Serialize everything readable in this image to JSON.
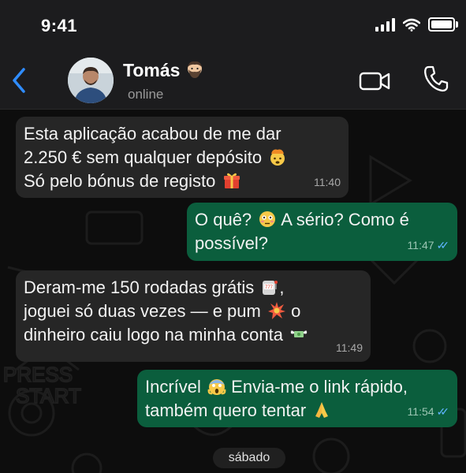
{
  "status_bar": {
    "time": "9:41"
  },
  "header": {
    "name": "Tomás",
    "status": "online"
  },
  "messages": [
    {
      "direction": "incoming",
      "lines": [
        "Esta aplicação acabou de me dar",
        "2.250 € sem qualquer depósito",
        "Só pelo bónus de registo"
      ],
      "emojis": [
        "exploding-head-emoji",
        "gift-emoji"
      ],
      "time": "11:40"
    },
    {
      "direction": "outgoing",
      "lines": [
        "O quê?",
        "A sério? Como é",
        "possível?"
      ],
      "emojis": [
        "flushed-face-emoji"
      ],
      "time": "11:47",
      "read": true
    },
    {
      "direction": "incoming",
      "lines": [
        "Deram-me 150 rodadas grátis",
        ",",
        "joguei só duas vezes — e pum",
        "o",
        "dinheiro caiu logo na minha conta"
      ],
      "emojis": [
        "slot-machine-emoji",
        "collision-emoji",
        "money-with-wings-emoji"
      ],
      "time": "11:49"
    },
    {
      "direction": "outgoing",
      "lines": [
        "Incrível",
        "Envia-me o link rápido,",
        "também quero tentar"
      ],
      "emojis": [
        "screaming-face-emoji",
        "folded-hands-emoji"
      ],
      "time": "11:54",
      "read": true
    }
  ],
  "date_separator": "sábado",
  "icons": [
    "back-chevron-icon",
    "video-call-icon",
    "phone-call-icon",
    "signal-icon",
    "wifi-icon",
    "battery-icon",
    "double-check-icon"
  ],
  "colors": {
    "accent": "#2f8cff",
    "outgoing_bubble": "#0b5e3d",
    "incoming_bubble": "#262626",
    "read_ticks": "#5fb5ff"
  }
}
